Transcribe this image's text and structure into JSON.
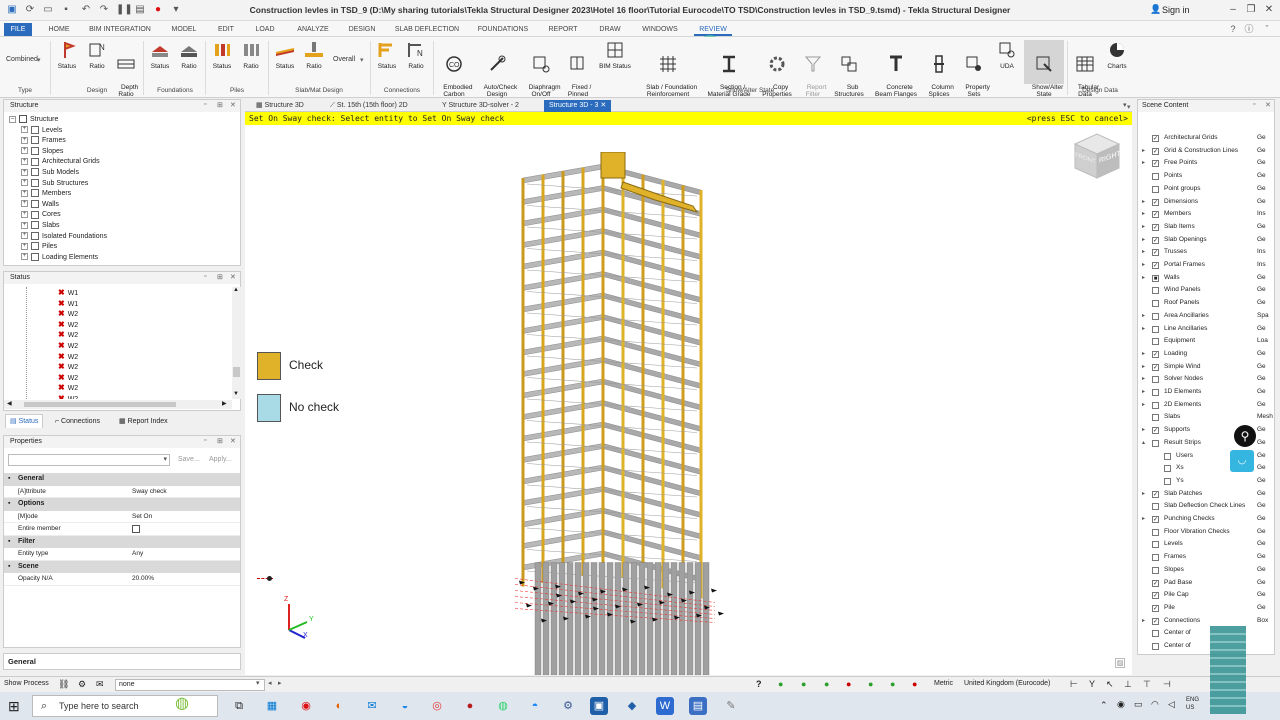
{
  "window": {
    "title": "Construction levles in TSD_9 (D:\\My sharing tutorials\\Tekla Structural Designer 2023\\Hotel 16 floor\\Tutorial Eurocode\\TO TSD\\Construction levles in TSD_9.tsmd) - Tekla Structural Designer",
    "signin": "Sign in"
  },
  "menu": [
    "FILE",
    "HOME",
    "BIM INTEGRATION",
    "MODEL",
    "EDIT",
    "LOAD",
    "ANALYZE",
    "DESIGN",
    "SLAB DEFLECTION",
    "FOUNDATIONS",
    "REPORT",
    "DRAW",
    "WINDOWS",
    "REVIEW"
  ],
  "ribbon": {
    "combined": "Combined",
    "overall": "Overall",
    "buttons": {
      "status1": "Status",
      "ratio1": "Ratio",
      "depth_ratio": "Depth\nRatio",
      "status2": "Status",
      "ratio2": "Ratio",
      "status3": "Status",
      "ratio3": "Ratio",
      "status4": "Status",
      "ratio4": "Ratio",
      "status5": "Status",
      "ratio5": "Ratio",
      "embodied": "Embodied\nCarbon",
      "autocheck": "Auto/Check\nDesign",
      "diaphragm": "Diaphragm\nOn/Off",
      "fixed": "Fixed /\nPinned",
      "bim_status": "BIM Status",
      "slab_found": "Slab / Foundation\nReinforcement",
      "section": "Section /\nMaterial Grade",
      "copy_props": "Copy\nProperties",
      "report_filter": "Report\nFilter",
      "sub_struct": "Sub\nStructures",
      "concrete_beam": "Concrete\nBeam Flanges",
      "column_splices": "Column\nSplices",
      "property_sets": "Property\nSets",
      "uda": "UDA",
      "show_alter": "Show/Alter\nState",
      "tabular": "Tabular\nData",
      "charts": "Charts"
    },
    "groups": {
      "type": "Type",
      "design": "Design",
      "foundations": "Foundations",
      "piles": "Piles",
      "slabmat": "Slab/Mat Design",
      "connections": "Connections",
      "show_alter": "Show/Alter State",
      "design_data": "Design Data"
    }
  },
  "structure_panel": {
    "title": "Structure",
    "root": "Structure",
    "items": [
      "Levels",
      "Frames",
      "Slopes",
      "Architectural Grids",
      "Sub Models",
      "Sub Structures",
      "Members",
      "Walls",
      "Cores",
      "Slabs",
      "Isolated Foundations",
      "Piles",
      "Loading Elements"
    ]
  },
  "status_panel": {
    "title": "Status",
    "items": [
      "W1",
      "W1",
      "W2",
      "W2",
      "W2",
      "W2",
      "W2",
      "W2",
      "W2",
      "W2",
      "W2"
    ],
    "tabs": [
      "Status",
      "Connections",
      "Report Index"
    ]
  },
  "properties_panel": {
    "title": "Properties",
    "save": "Save...",
    "apply": "Apply...",
    "categories": {
      "general": "General",
      "attribute_k": "[A]ttribute",
      "attribute_v": "Sway check",
      "options": "Options",
      "mode_k": "[M]ode",
      "mode_v": "Set On",
      "entire_k": "Entire member",
      "filter": "Filter",
      "entity_k": "Entity type",
      "entity_v": "Any",
      "scene": "Scene",
      "opacity_k": "Opacity N/A",
      "opacity_v": "20.00%"
    },
    "footer": "General"
  },
  "doc_tabs": [
    "Structure 3D",
    "St. 15th (15th floor) 2D",
    "Structure 3D-solver - 2",
    "Structure 3D - 3"
  ],
  "command": {
    "prompt": "Set On Sway check: Select entity to Set On Sway check",
    "escape": "<press ESC to cancel>"
  },
  "legend": {
    "check": "Check",
    "no_check": "No check",
    "check_color": "#e0b22a",
    "no_check_color": "#a9dbe6"
  },
  "viewcube": {
    "front": "FRONT",
    "right": "RIGHT"
  },
  "axis": {
    "z": "Z",
    "y": "Y",
    "x": "X"
  },
  "scene_panel": {
    "title": "Scene Content",
    "rows": [
      {
        "name": "Architectural Grids",
        "val": "Ge",
        "arrow": false,
        "checked": true
      },
      {
        "name": "Grid & Construction Lines",
        "val": "Ge",
        "arrow": true,
        "checked": true
      },
      {
        "name": "Free Points",
        "val": "Ge",
        "arrow": true,
        "checked": true
      },
      {
        "name": "Points",
        "val": "Ge",
        "arrow": false,
        "checked": false
      },
      {
        "name": "Point groups",
        "val": "Ge",
        "arrow": false,
        "checked": false
      },
      {
        "name": "Dimensions",
        "val": "Ge",
        "arrow": true,
        "checked": true
      },
      {
        "name": "Members",
        "val": "Ins",
        "arrow": true,
        "checked": true
      },
      {
        "name": "Slab Items",
        "val": "Ge",
        "arrow": true,
        "checked": true
      },
      {
        "name": "Slab Openings",
        "val": "Ge",
        "arrow": true,
        "checked": true
      },
      {
        "name": "Trusses",
        "val": "Ins",
        "arrow": true,
        "checked": true
      },
      {
        "name": "Portal Frames",
        "val": "Ins",
        "arrow": true,
        "checked": true
      },
      {
        "name": "Walls",
        "val": "Ge",
        "arrow": true,
        "checked": "partial"
      },
      {
        "name": "Wind Panels",
        "val": "Ge",
        "arrow": false,
        "checked": false
      },
      {
        "name": "Roof Panels",
        "val": "Ge",
        "arrow": false,
        "checked": false
      },
      {
        "name": "Area Ancillaries",
        "val": "Spa",
        "arrow": true,
        "checked": false
      },
      {
        "name": "Line Ancillaries",
        "val": "Ge",
        "arrow": true,
        "checked": false
      },
      {
        "name": "Equipment",
        "val": "Loa",
        "arrow": false,
        "checked": false
      },
      {
        "name": "Loading",
        "val": "Ge",
        "arrow": true,
        "checked": true
      },
      {
        "name": "Simple Wind",
        "val": "Ge",
        "arrow": true,
        "checked": true
      },
      {
        "name": "Solver Nodes",
        "val": "Ge",
        "arrow": true,
        "checked": false
      },
      {
        "name": "1D Elements",
        "val": "Ge",
        "arrow": true,
        "checked": false
      },
      {
        "name": "2D Elements",
        "val": "Ge",
        "arrow": true,
        "checked": false
      },
      {
        "name": "Slabs",
        "val": "Mesh",
        "arrow": false,
        "checked": false
      },
      {
        "name": "Supports",
        "val": "Ge",
        "arrow": true,
        "checked": true
      },
      {
        "name": "Result Strips",
        "val": "Ge",
        "arrow": "open",
        "checked": false
      },
      {
        "name": "Users",
        "val": "Ge",
        "arrow": false,
        "checked": false,
        "indent": true
      },
      {
        "name": "Xs",
        "val": "Ge",
        "arrow": false,
        "checked": false,
        "indent": true
      },
      {
        "name": "Ys",
        "val": "Ge",
        "arrow": false,
        "checked": false,
        "indent": true
      },
      {
        "name": "Slab Patches",
        "val": "Ge",
        "arrow": true,
        "checked": true
      },
      {
        "name": "Slab Deflection Check Lines",
        "val": "Ge",
        "arrow": false,
        "checked": false
      },
      {
        "name": "Punching Checks",
        "val": "Ge",
        "arrow": true,
        "checked": true
      },
      {
        "name": "Floor Vibration Checks",
        "val": "Ge",
        "arrow": false,
        "checked": false
      },
      {
        "name": "Levels",
        "val": "Ge",
        "arrow": false,
        "checked": false
      },
      {
        "name": "Frames",
        "val": "Ge",
        "arrow": false,
        "checked": false
      },
      {
        "name": "Slopes",
        "val": "Ge",
        "arrow": false,
        "checked": false
      },
      {
        "name": "Pad Base",
        "val": "Ge",
        "arrow": false,
        "checked": true
      },
      {
        "name": "Pile Cap",
        "val": "Ge",
        "arrow": false,
        "checked": true
      },
      {
        "name": "Pile",
        "val": "Ge",
        "arrow": false,
        "checked": true
      },
      {
        "name": "Connections",
        "val": "Box",
        "arrow": true,
        "checked": true
      },
      {
        "name": "Center of",
        "val": "",
        "arrow": false,
        "checked": false
      },
      {
        "name": "Center of",
        "val": "",
        "arrow": false,
        "checked": false
      }
    ]
  },
  "statusbar": {
    "show_process": "Show Process",
    "filter_value": "none",
    "units": "Metric",
    "code": "United Kingdom (Eurocode)"
  },
  "taskbar": {
    "search_placeholder": "Type here to search",
    "lang": "ENG\nUS"
  }
}
